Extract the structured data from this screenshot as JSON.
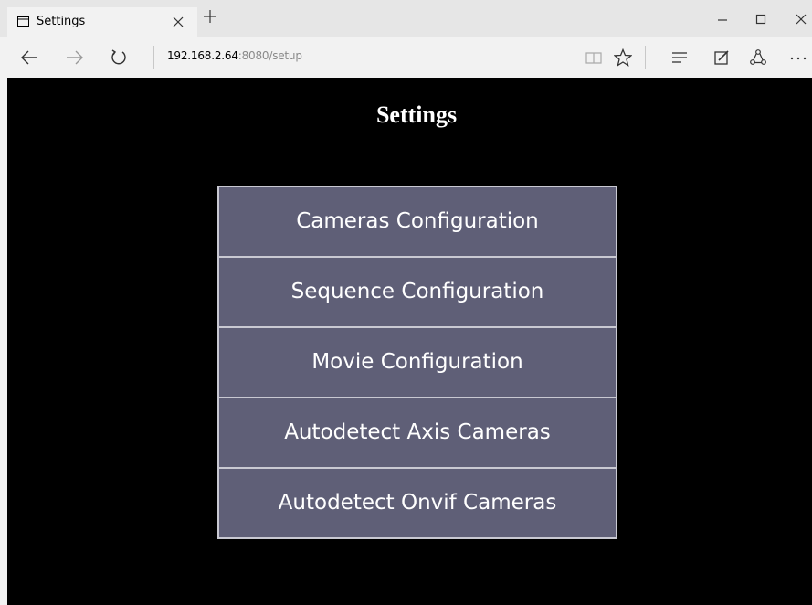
{
  "browser": {
    "tab": {
      "title": "Settings"
    },
    "address": {
      "host": "192.168.2.64",
      "rest": ":8080/setup"
    }
  },
  "page": {
    "title": "Settings",
    "menu": [
      {
        "label": "Cameras Configuration"
      },
      {
        "label": "Sequence Configuration"
      },
      {
        "label": "Movie Configuration"
      },
      {
        "label": "Autodetect Axis Cameras"
      },
      {
        "label": "Autodetect Onvif Cameras"
      }
    ]
  },
  "colors": {
    "page_background": "#000000",
    "menu_item_background": "#5f5f77",
    "menu_border": "#c9c9d2",
    "chrome_tabbar": "#e6e6e6",
    "chrome_navbar": "#f2f2f2"
  },
  "icons": [
    "tab-page-icon",
    "close-icon",
    "plus-icon",
    "minimize-icon",
    "maximize-icon",
    "back-icon",
    "forward-icon",
    "refresh-icon",
    "reading-view-icon",
    "favorite-star-icon",
    "hub-icon",
    "web-note-icon",
    "share-icon",
    "more-icon"
  ]
}
